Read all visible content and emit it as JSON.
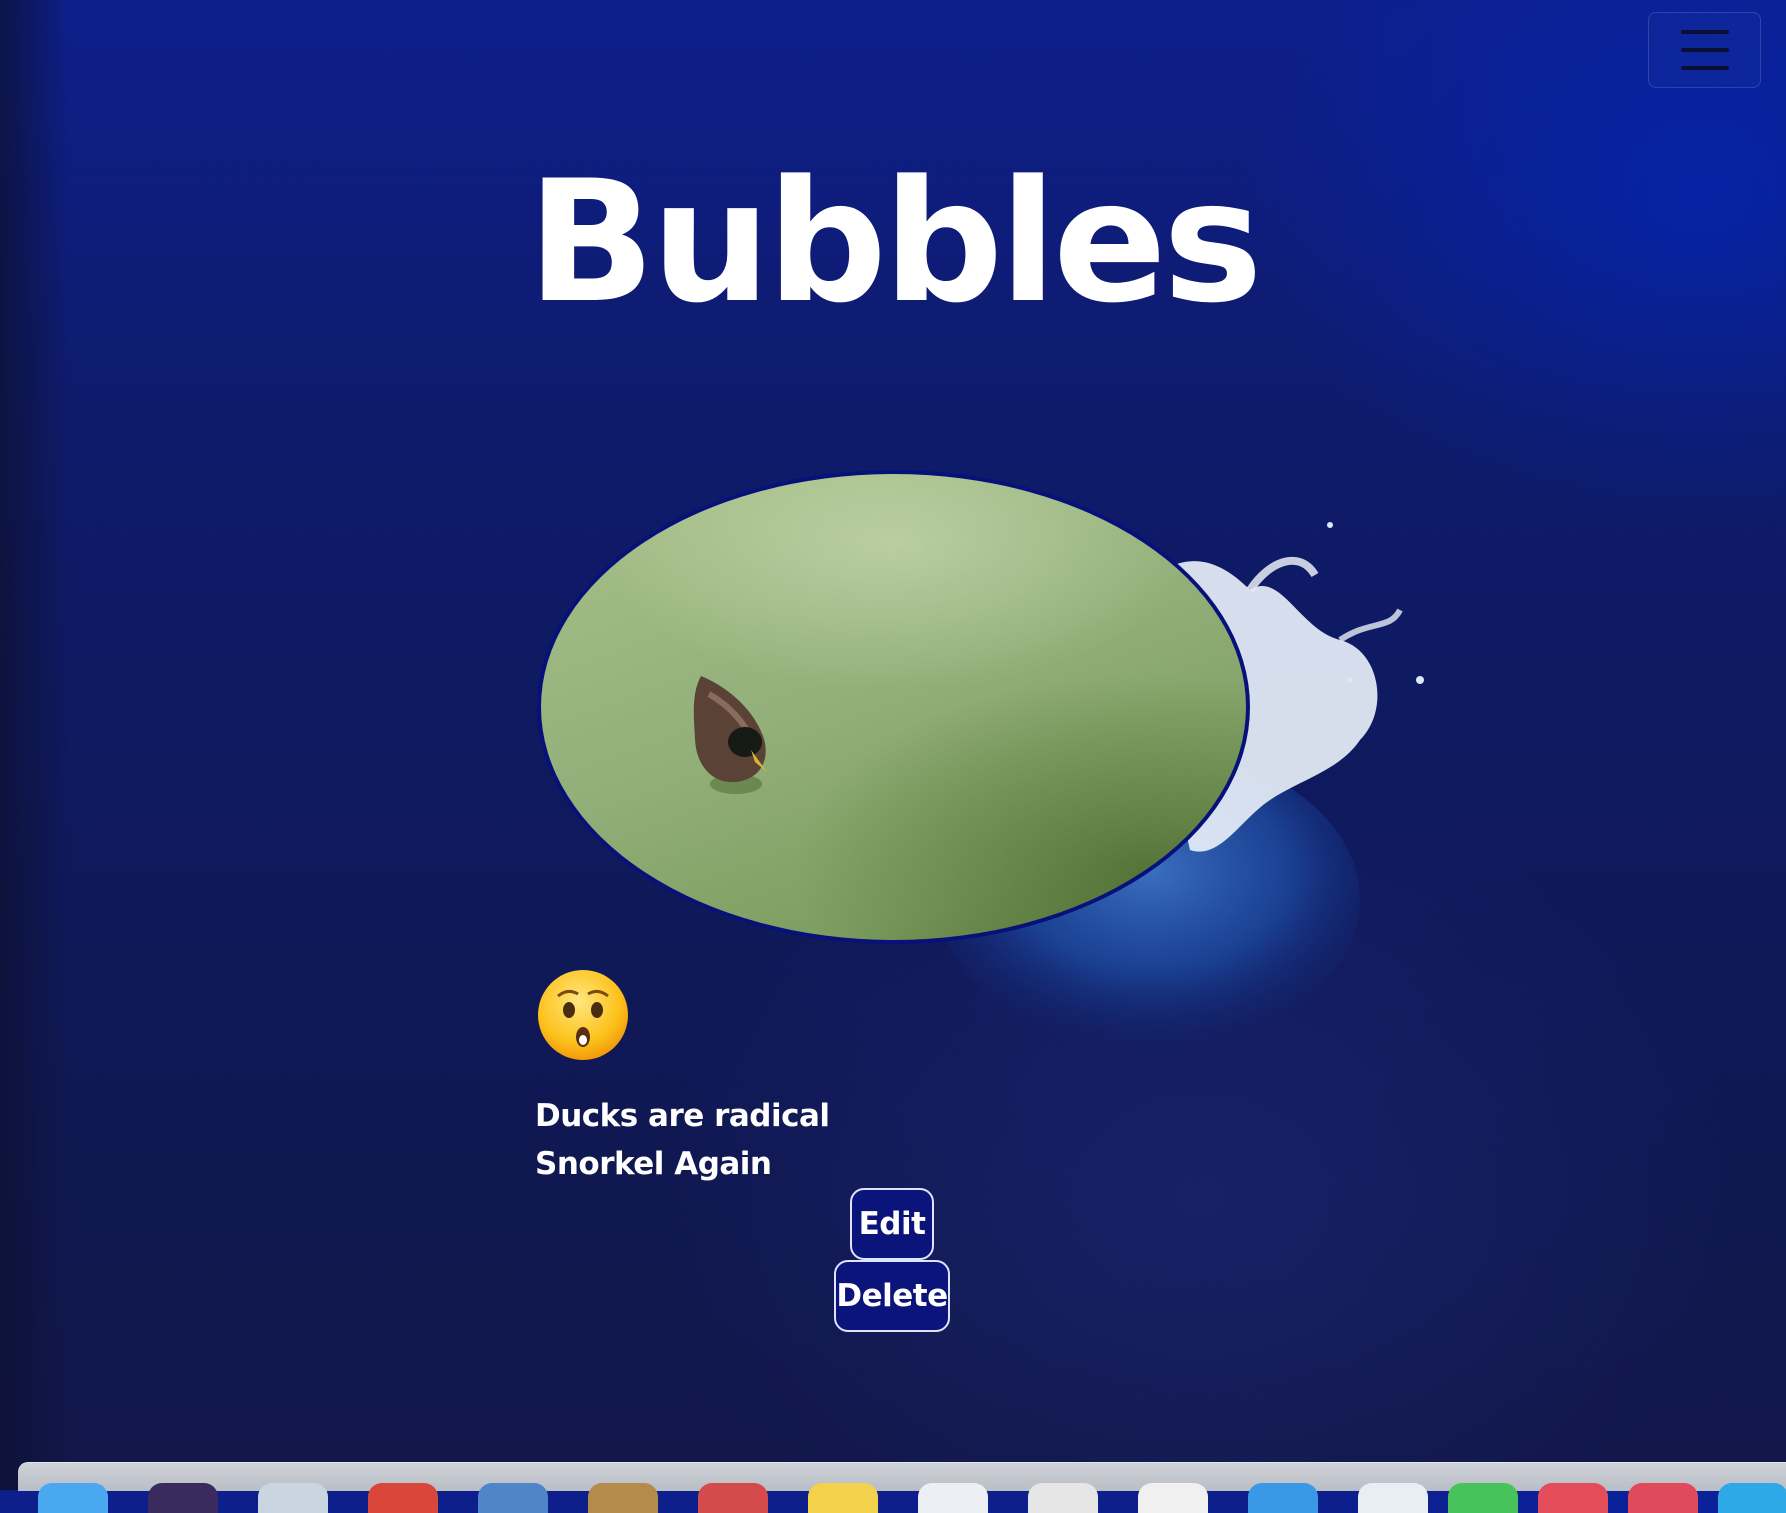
{
  "nav": {
    "menu_icon": "hamburger-menu-icon"
  },
  "page": {
    "title": "Bubbles"
  },
  "post": {
    "image_alt": "duck swimming in green water",
    "emoji": "😲",
    "caption_line_1": "Ducks are radical",
    "caption_line_2": "Snorkel Again"
  },
  "actions": {
    "edit_label": "Edit",
    "delete_label": "Delete"
  },
  "colors": {
    "background": "#0e1b6b",
    "button_bg": "#0a147a",
    "image_border": "#07117a",
    "text": "#ffffff"
  }
}
